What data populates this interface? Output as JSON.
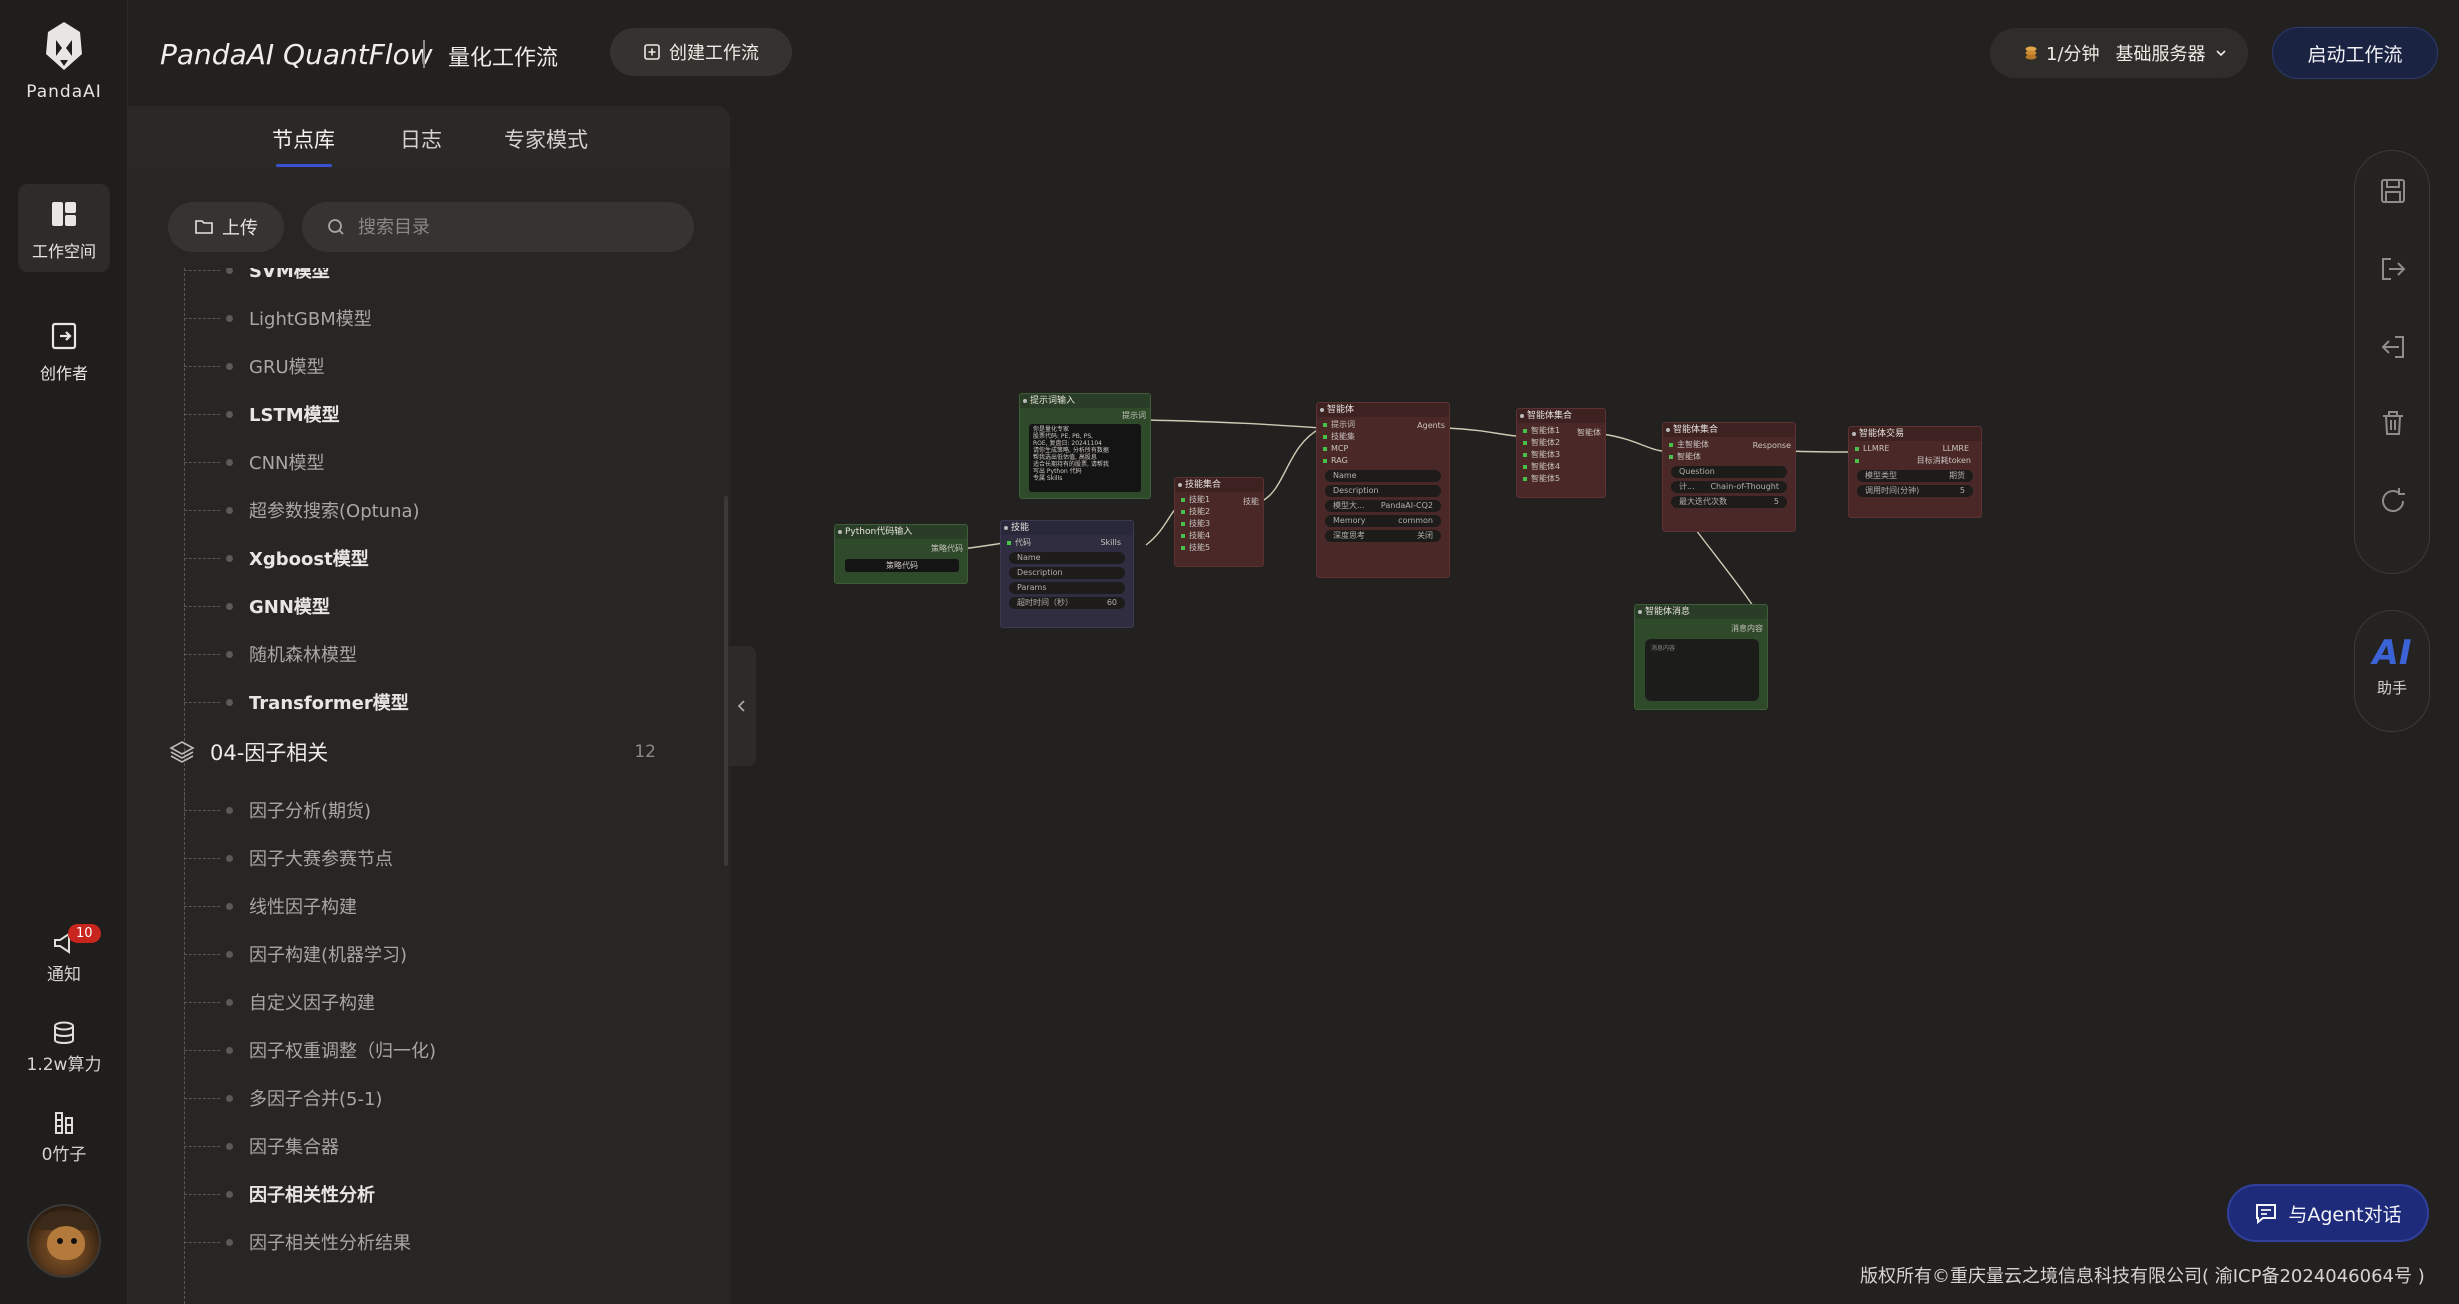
{
  "brand": {
    "name": "PandaAI"
  },
  "rail": {
    "workspace_label": "工作空间",
    "creator_label": "创作者",
    "notify_label": "通知",
    "notify_count": "10",
    "compute_label": "1.2w算力",
    "bamboo_label": "0竹子"
  },
  "header": {
    "title": "PandaAI QuantFlow",
    "subtitle": "量化工作流",
    "create_label": "创建工作流",
    "rate": "1/分钟",
    "server": "基础服务器",
    "start_label": "启动工作流"
  },
  "panel": {
    "tabs": [
      {
        "label": "节点库",
        "active": true
      },
      {
        "label": "日志",
        "active": false
      },
      {
        "label": "专家模式",
        "active": false
      }
    ],
    "upload_label": "上传",
    "search_placeholder": "搜索目录",
    "partial_item": "SVM模型",
    "group1_items": [
      {
        "label": "LightGBM模型",
        "bold": false
      },
      {
        "label": "GRU模型",
        "bold": false
      },
      {
        "label": "LSTM模型",
        "bold": true
      },
      {
        "label": "CNN模型",
        "bold": false
      },
      {
        "label": "超参数搜索(Optuna)",
        "bold": false
      },
      {
        "label": "Xgboost模型",
        "bold": true
      },
      {
        "label": "GNN模型",
        "bold": true
      },
      {
        "label": "随机森林模型",
        "bold": false
      },
      {
        "label": "Transformer模型",
        "bold": true
      }
    ],
    "group2": {
      "title": "04-因子相关",
      "count": "12"
    },
    "group2_items": [
      {
        "label": "因子分析(期货)",
        "bold": false
      },
      {
        "label": "因子大赛参赛节点",
        "bold": false
      },
      {
        "label": "线性因子构建",
        "bold": false
      },
      {
        "label": "因子构建(机器学习)",
        "bold": false
      },
      {
        "label": "自定义因子构建",
        "bold": false
      },
      {
        "label": "因子权重调整（归一化)",
        "bold": false
      },
      {
        "label": "多因子合并(5-1)",
        "bold": false
      },
      {
        "label": "因子集合器",
        "bold": false
      },
      {
        "label": "因子相关性分析",
        "bold": true
      },
      {
        "label": "因子相关性分析结果",
        "bold": false
      }
    ]
  },
  "canvas": {
    "nodes": {
      "python_input": {
        "title": "Python代码输入",
        "out": "策略代码",
        "button": "策略代码"
      },
      "prompt_input": {
        "title": "提示词输入",
        "out": "提示词",
        "text": "你是量化专家\n股票代码: PE, PB, PS,\nROE, 复盘日: 20241104\n请你生成策略, 分析所有数据\n帮我选出低估值, 高股息\n适合长期持有的股票, 请帮我\n写出 Python 代码\n专属 Skills"
      },
      "skill": {
        "title": "技能",
        "in": "代码",
        "out": "Skills",
        "fields": [
          "Name",
          "Description",
          "Params"
        ],
        "stepper_label": "超时时间（秒）",
        "stepper_value": "60"
      },
      "skill_set": {
        "title": "技能集合",
        "out": "技能",
        "rows": [
          "技能1",
          "技能2",
          "技能3",
          "技能4",
          "技能5"
        ]
      },
      "agent": {
        "title": "智能体",
        "out": "Agents",
        "rows": [
          "提示词",
          "技能集",
          "MCP",
          "RAG"
        ],
        "fields": [
          "Name",
          "Description"
        ],
        "model_label": "模型大...",
        "model_value": "PandaAI-CQ2",
        "memory_label": "Memory",
        "memory_value": "common",
        "think_label": "深度思考",
        "think_value": "关闭"
      },
      "agent_set": {
        "title": "智能体集合",
        "out": "智能体",
        "rows": [
          "智能体1",
          "智能体2",
          "智能体3",
          "智能体4",
          "智能体5"
        ]
      },
      "agent_team": {
        "title": "智能体集合",
        "out": "Response",
        "rows": [
          "主智能体",
          "智能体"
        ],
        "field": "Question",
        "mode_label": "计...",
        "mode_value": "Chain-of-Thought",
        "steps_label": "最大迭代次数",
        "steps_value": "5"
      },
      "agent_chat": {
        "title": "智能体交易",
        "in": "LLMRE",
        "out": "LLMRE",
        "rows": [
          "目标消耗token"
        ],
        "model_label": "模型类型",
        "model_value": "期货",
        "time_label": "调用时间(分钟)",
        "time_value": "5"
      },
      "agent_msg": {
        "title": "智能体消息",
        "out": "消息内容",
        "text": "消息内容"
      }
    }
  },
  "right_tools": [
    "save-icon",
    "export-icon",
    "import-icon",
    "delete-icon",
    "refresh-icon"
  ],
  "ai_assistant": {
    "logo": "AI",
    "label": "助手"
  },
  "agent_chat_label": "与Agent对话",
  "copyright": "版权所有©重庆量云之境信息科技有限公司( 渝ICP备2024046064号 )"
}
